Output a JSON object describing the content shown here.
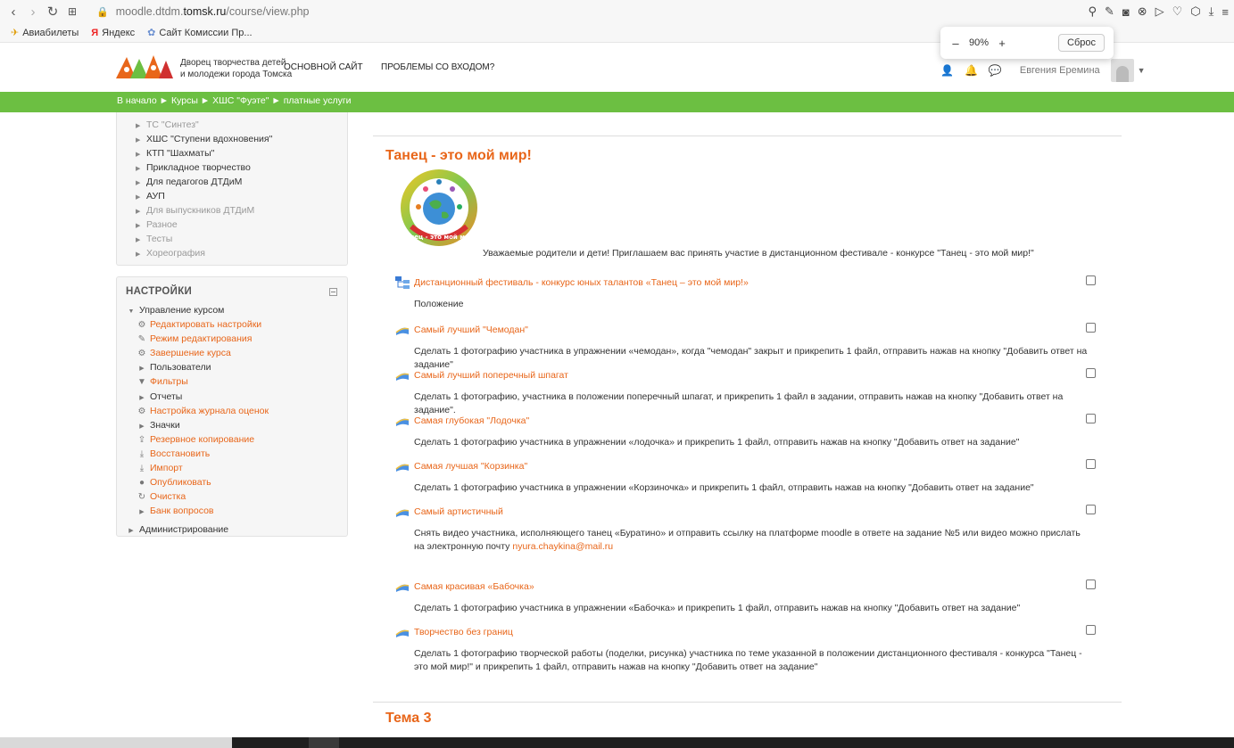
{
  "browser": {
    "url_prefix": "moodle.dtdm.",
    "url_domain": "tomsk.ru",
    "url_path": "/course/view.php",
    "zoom": {
      "value": "90%",
      "minus": "–",
      "plus": "+",
      "reset": "Сброс"
    },
    "bookmarks": [
      {
        "label": "Авиабилеты",
        "icon": "plane-icon"
      },
      {
        "label": "Яндекс",
        "icon": "yandex-icon"
      },
      {
        "label": "Сайт Комиссии Пр...",
        "icon": "site-icon"
      }
    ]
  },
  "header": {
    "org_line1": "Дворец творчества детей",
    "org_line2": "и молодежи города Томска",
    "nav": [
      "ОСНОВНОЙ САЙТ",
      "ПРОБЛЕМЫ СО ВХОДОМ?"
    ],
    "user_name": "Евгения Еремина"
  },
  "breadcrumb": {
    "items": [
      "В начало",
      "Курсы",
      "ХШС \"Фуэте\"",
      "платные услуги"
    ],
    "separator": "►"
  },
  "categories": [
    {
      "label": "ТС \"Синтез\"",
      "dim": true
    },
    {
      "label": "ХШС \"Ступени вдохновения\"",
      "dim": false
    },
    {
      "label": "КТП \"Шахматы\"",
      "dim": false
    },
    {
      "label": "Прикладное творчество",
      "dim": false
    },
    {
      "label": "Для педагогов ДТДиМ",
      "dim": false
    },
    {
      "label": "АУП",
      "dim": false
    },
    {
      "label": "Для выпускников ДТДиМ",
      "dim": true
    },
    {
      "label": "Разное",
      "dim": true
    },
    {
      "label": "Тесты",
      "dim": true
    },
    {
      "label": "Хореография",
      "dim": true
    }
  ],
  "settings": {
    "title": "НАСТРОЙКИ",
    "items": [
      {
        "label": "Управление курсом",
        "level": 0,
        "icon": "triangle-down-icon",
        "link": false
      },
      {
        "label": "Редактировать настройки",
        "level": 1,
        "icon": "gear-icon",
        "link": true
      },
      {
        "label": "Режим редактирования",
        "level": 1,
        "icon": "pencil-icon",
        "link": true
      },
      {
        "label": "Завершение курса",
        "level": 1,
        "icon": "gear-icon",
        "link": true
      },
      {
        "label": "Пользователи",
        "level": 1,
        "icon": "triangle-right-icon",
        "link": false
      },
      {
        "label": "Фильтры",
        "level": 1,
        "icon": "filter-icon",
        "link": true
      },
      {
        "label": "Отчеты",
        "level": 1,
        "icon": "triangle-right-icon",
        "link": false
      },
      {
        "label": "Настройка журнала оценок",
        "level": 1,
        "icon": "gear-icon",
        "link": true
      },
      {
        "label": "Значки",
        "level": 1,
        "icon": "triangle-right-icon",
        "link": false
      },
      {
        "label": "Резервное копирование",
        "level": 1,
        "icon": "upload-icon",
        "link": true
      },
      {
        "label": "Восстановить",
        "level": 1,
        "icon": "download-icon",
        "link": true
      },
      {
        "label": "Импорт",
        "level": 1,
        "icon": "download-icon",
        "link": true
      },
      {
        "label": "Опубликовать",
        "level": 1,
        "icon": "globe-icon",
        "link": true
      },
      {
        "label": "Очистка",
        "level": 1,
        "icon": "refresh-icon",
        "link": true
      },
      {
        "label": "Банк вопросов",
        "level": 1,
        "icon": "triangle-right-icon",
        "link": true
      },
      {
        "label": "Администрирование",
        "level": 0,
        "icon": "triangle-right-icon",
        "link": false
      }
    ]
  },
  "section": {
    "title": "Танец - это мой мир!",
    "logo_text": "Танец - это мой мир!",
    "intro": "Уважаемые родители и дети! Приглашаем вас принять участие в дистанционном фестивале - конкурсе \"Танец - это мой мир!\"",
    "activities": [
      {
        "title": "Дистанционный фестиваль - конкурс юных талантов «Танец – это мой мир!»",
        "icon": "folder-tree-icon",
        "desc": "Положение"
      },
      {
        "title": "Самый лучший \"Чемодан\"",
        "icon": "assignment-icon",
        "desc": "Сделать 1 фотографию участника в упражнении «чемодан», когда \"чемодан\" закрыт и прикрепить 1 файл, отправить нажав на кнопку \"Добавить ответ на задание\""
      },
      {
        "title": "Самый лучший поперечный шпагат",
        "icon": "assignment-icon",
        "desc": "Сделать 1 фотографию, участника в положении поперечный шпагат, и прикрепить 1 файл в задании, отправить нажав на кнопку \"Добавить ответ на задание\"."
      },
      {
        "title": "Самая глубокая \"Лодочка\"",
        "icon": "assignment-icon",
        "desc": "Сделать 1 фотографию участника в упражнении «лодочка» и прикрепить 1 файл, отправить нажав на кнопку \"Добавить ответ на задание\""
      },
      {
        "title": "Самая лучшая \"Корзинка\"",
        "icon": "assignment-icon",
        "desc": "Сделать 1 фотографию участника в упражнении «Корзиночка» и прикрепить 1 файл, отправить нажав на кнопку \"Добавить ответ на задание\""
      },
      {
        "title": "Самый артистичный",
        "icon": "assignment-icon",
        "desc": "Снять видео участника, исполняющего танец «Буратино» и отправить ссылку на платформе moodle в ответе на задание  №5  или видео можно прислать на электронную почту ",
        "email": "nyura.chaykina@mail.ru"
      },
      {
        "title": "Самая красивая «Бабочка»",
        "icon": "assignment-icon",
        "desc": "Сделать 1 фотографию участника в упражнении «Бабочка» и прикрепить 1 файл, отправить нажав на кнопку \"Добавить ответ на задание\""
      },
      {
        "title": "Творчество без границ",
        "icon": "assignment-icon",
        "desc": "Сделать 1 фотографию творческой работы (поделки, рисунка) участника по теме указанной в положении дистанционного фестиваля -  конкурса \"Танец - это мой мир!\"  и прикрепить 1 файл, отправить нажав на кнопку \"Добавить ответ на задание\""
      }
    ]
  },
  "next_section_title": "Тема 3",
  "colors": {
    "accent": "#e8661a",
    "crumb_bar": "#6cbf42"
  }
}
